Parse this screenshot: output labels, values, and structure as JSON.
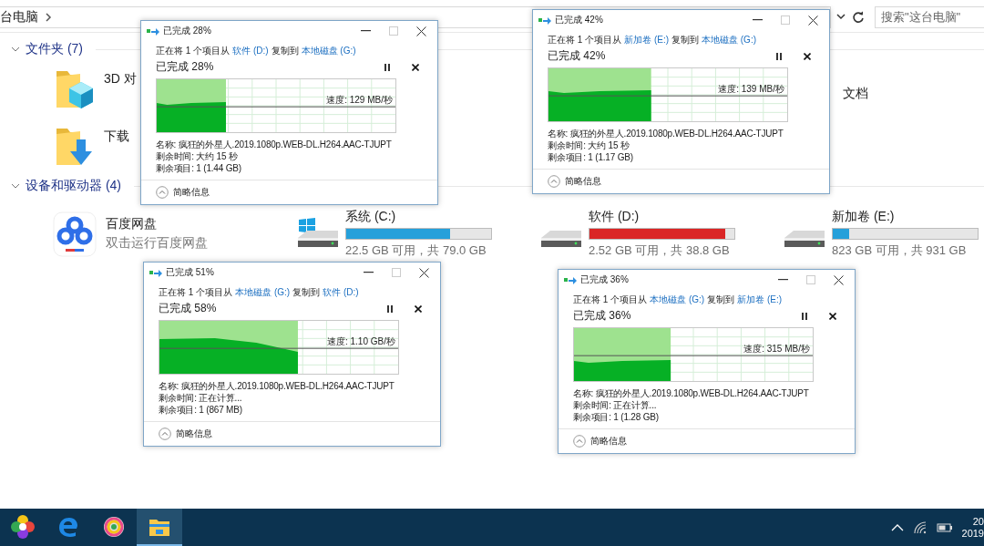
{
  "explorer": {
    "breadcrumb": "台电脑",
    "search": {
      "placeholder": "搜索\"这台电脑\""
    },
    "sections": [
      {
        "title": "文件夹 (7)",
        "items": [
          {
            "kind": "objects3d",
            "name": "3D 对"
          },
          {
            "kind": "documents",
            "name": "文档"
          },
          {
            "kind": "downloads",
            "name": "下载"
          }
        ]
      },
      {
        "title": "设备和驱动器 (4)",
        "items": [
          {
            "kind": "app",
            "name": "百度网盘",
            "subtitle": "双击运行百度网盘"
          },
          {
            "kind": "system-drive",
            "name": "系统 (C:)",
            "level": 0.715,
            "color": "#26a0da",
            "capacity": "22.5 GB 可用，共 79.0 GB"
          },
          {
            "kind": "drive",
            "name": "软件 (D:)",
            "level": 0.935,
            "color": "#da2626",
            "capacity": "2.52 GB 可用，共 38.8 GB"
          },
          {
            "kind": "drive",
            "name": "新加卷 (E:)",
            "level": 0.116,
            "color": "#26a0da",
            "capacity": "823 GB 可用，共 931 GB"
          }
        ]
      }
    ]
  },
  "dialogs": [
    {
      "title": "已完成 28%",
      "copy_text": "正在将 1 个项目从",
      "source": "软件 (D:)",
      "copy_to": "复制到",
      "destination": "本地磁盘 (G:)",
      "heading": "已完成 28%",
      "speed": "速度: 129 MB/秒",
      "level": 0.29,
      "details": [
        "名称: 疯狂的外星人.2019.1080p.WEB-DL.H264.AAC-TJUPT",
        "剩余时间: 大约 15 秒",
        "剩余项目: 1 (1.44 GB)"
      ],
      "footer": "简略信息"
    },
    {
      "title": "已完成 42%",
      "copy_text": "正在将 1 个项目从",
      "source": "新加卷 (E:)",
      "copy_to": "复制到",
      "destination": "本地磁盘 (G:)",
      "heading": "已完成 42%",
      "speed": "速度: 139 MB/秒",
      "level": 0.43,
      "details": [
        "名称: 疯狂的外星人.2019.1080p.WEB-DL.H264.AAC-TJUPT",
        "剩余时间: 大约 15 秒",
        "剩余项目: 1 (1.17 GB)"
      ],
      "footer": "简略信息"
    },
    {
      "title": "已完成 51%",
      "copy_text": "正在将 1 个项目从",
      "source": "本地磁盘 (G:)",
      "copy_to": "复制到",
      "destination": "软件 (D:)",
      "heading": "已完成 58%",
      "speed": "速度: 1.10 GB/秒",
      "level": 0.58,
      "details": [
        "名称: 疯狂的外星人.2019.1080p.WEB-DL.H264.AAC-TJUPT",
        "剩余时间: 正在计算...",
        "剩余项目: 1 (867 MB)"
      ],
      "footer": "简略信息"
    },
    {
      "title": "已完成 36%",
      "copy_text": "正在将 1 个项目从",
      "source": "本地磁盘 (G:)",
      "copy_to": "复制到",
      "destination": "新加卷 (E:)",
      "heading": "已完成 36%",
      "speed": "速度: 315 MB/秒",
      "level": 0.405,
      "details": [
        "名称: 疯狂的外星人.2019.1080p.WEB-DL.H264.AAC-TJUPT",
        "剩余时间: 正在计算...",
        "剩余项目: 1 (1.28 GB)"
      ],
      "footer": "简略信息"
    }
  ],
  "taskbar": {
    "apps": [
      {
        "kind": "pinwheel",
        "selected": false
      },
      {
        "kind": "edge",
        "selected": false
      },
      {
        "kind": "disc",
        "selected": false
      },
      {
        "kind": "explorer",
        "selected": true
      }
    ],
    "clock": [
      "20",
      "2019"
    ]
  }
}
